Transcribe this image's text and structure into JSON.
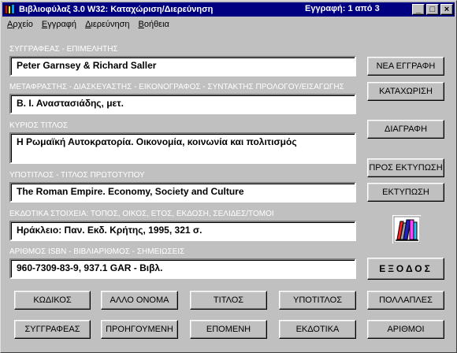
{
  "window": {
    "title": "Βιβλιοφύλαξ 3.0 W32: Καταχώριση/Διερεύνηση",
    "record_info": "Εγγραφή:  1  από  3",
    "controls": {
      "minimize": "_",
      "maximize": "□",
      "close": "×"
    }
  },
  "menu": {
    "items": [
      {
        "acc": "Α",
        "rest": "ρχείο"
      },
      {
        "acc": "Ε",
        "rest": "γγραφή"
      },
      {
        "acc": "Δ",
        "rest": "ιερεύνηση"
      },
      {
        "acc": "Β",
        "rest": "οήθεια"
      }
    ]
  },
  "fields": {
    "authors": {
      "label": "ΣΥΓΓΡΑΦΕΑΣ - ΕΠΙΜΕΛΗΤΗΣ",
      "value": "Peter Garnsey & Richard Saller"
    },
    "translators": {
      "label": "ΜΕΤΑΦΡΑΣΤΗΣ - ΔΙΑΣΚΕΥΑΣΤΗΣ - ΕΙΚΟΝΟΓΡΑΦΟΣ - ΣΥΝΤΑΚΤΗΣ ΠΡΟΛΟΓΟΥ/ΕΙΣΑΓΩΓΗΣ",
      "value": "Β. Ι. Αναστασιάδης, μετ."
    },
    "title": {
      "label": "ΚΥΡΙΟΣ ΤΙΤΛΟΣ",
      "value": "Η Ρωμαϊκή Αυτοκρατορία. Οικονομία, κοινωνία και πολιτισμός"
    },
    "subtitle": {
      "label": "ΥΠΟΤΙΤΛΟΣ - ΤΙΤΛΟΣ ΠΡΩΤΟΤΥΠΟΥ",
      "value": "The Roman Empire. Economy, Society and Culture"
    },
    "publication": {
      "label": "ΕΚΔΟΤΙΚΑ ΣΤΟΙΧΕΙΑ: ΤΟΠΟΣ, ΟΙΚΟΣ, ΕΤΟΣ, ΕΚΔΟΣΗ, ΣΕΛΙΔΕΣ/ΤΟΜΟΙ",
      "value": "Ηράκλειο: Παν. Εκδ. Κρήτης, 1995, 321 σ."
    },
    "isbn": {
      "label": "ΑΡΙΘΜΟΣ ISBN - ΒΙΒΛΙΑΡΙΘΜΟΣ - ΣΗΜΕΙΩΣΕΙΣ",
      "value": "960-7309-83-9, 937.1 GAR - Βιβλ."
    }
  },
  "side_buttons": {
    "new_record": "ΝΕΑ ΕΓΓΡΑΦΗ",
    "save": "ΚΑΤΑΧΩΡΙΣΗ",
    "delete": "ΔΙΑΓΡΑΦΗ",
    "to_print": "ΠΡΟΣ ΕΚΤΥΠΩΣΗ",
    "print": "ΕΚΤΥΠΩΣΗ",
    "exit": "ΕΞΟΔΟΣ"
  },
  "bottom_buttons": {
    "row1": [
      "ΚΩΔΙΚΟΣ",
      "ΑΛΛΟ ΟΝΟΜΑ",
      "ΤΙΤΛΟΣ",
      "ΥΠΟΤΙΤΛΟΣ",
      "ΠΟΛΛΑΠΛΕΣ"
    ],
    "row2": [
      "ΣΥΓΓΡΑΦΕΑΣ",
      "ΠΡΟΗΓΟΥΜΕΝΗ",
      "ΕΠΟΜΕΝΗ",
      "ΕΚΔΟΤΙΚΑ",
      "ΑΡΙΘΜΟΙ"
    ]
  },
  "colors": {
    "titlebar": "#000080",
    "face": "#c0c0c0",
    "label": "#ffffff"
  }
}
